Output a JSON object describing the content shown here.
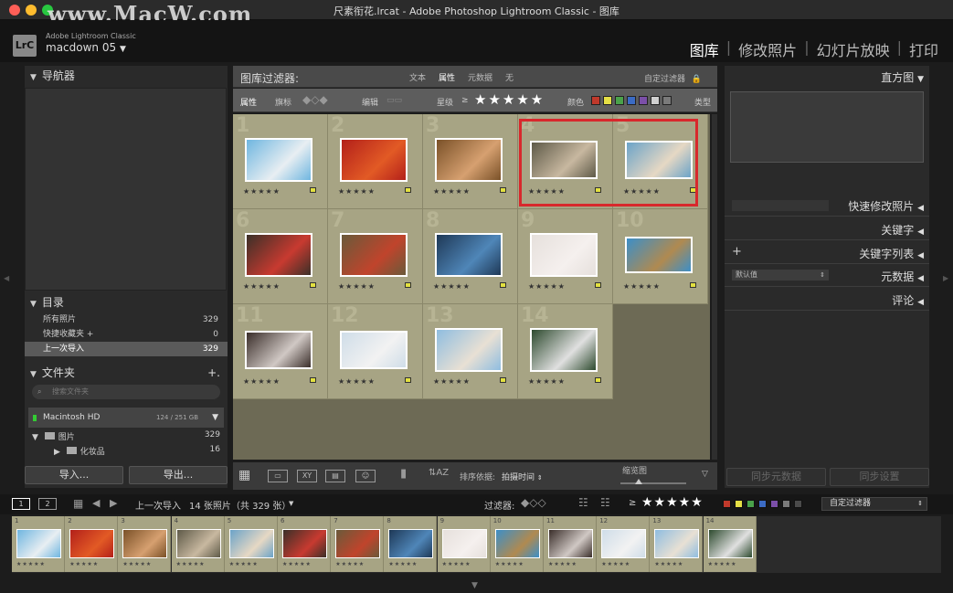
{
  "window": {
    "title": "尺素衔花.lrcat - Adobe Photoshop Lightroom Classic - 图库",
    "watermark": "www.MacW.com"
  },
  "identity": {
    "logo": "LrC",
    "app_name": "Adobe Lightroom Classic",
    "catalog": "macdown 05",
    "dropdown": "▼"
  },
  "modules": [
    "图库",
    "修改照片",
    "幻灯片放映",
    "打印"
  ],
  "left_panel": {
    "navigator": "导航器",
    "catalog": {
      "title": "目录",
      "items": [
        {
          "label": "所有照片",
          "count": "329"
        },
        {
          "label": "快捷收藏夹 +",
          "count": "0"
        },
        {
          "label": "上一次导入",
          "count": "329"
        }
      ]
    },
    "folders": {
      "title": "文件夹",
      "add": "+.",
      "search_placeholder": "搜索文件夹",
      "volume": "Macintosh HD",
      "volume_size": "124 / 251 GB",
      "items": [
        {
          "label": "图片",
          "count": "329"
        },
        {
          "label": "化妆品",
          "count": "16"
        }
      ]
    },
    "import_button": "导入...",
    "export_button": "导出..."
  },
  "filter_bar": {
    "label": "图库过滤器:",
    "tabs": [
      "文本",
      "属性",
      "元数据",
      "无"
    ],
    "active_tab": "属性",
    "custom": "自定过滤器",
    "lock_icon": "lock-icon"
  },
  "attribute_bar": {
    "attr": "属性",
    "flag": "旗标",
    "edit": "编辑",
    "rating": "星级",
    "gte": "≥",
    "stars": "★★★★★",
    "color": "颜色",
    "type": "类型",
    "colors": [
      "#c0392b",
      "#e6e045",
      "#4aa24a",
      "#3b6bc4",
      "#7b4fa8",
      "#d0d0d0",
      "#7a7a7a"
    ]
  },
  "grid": {
    "cells": [
      {
        "num": "1",
        "rating": "★★★★★",
        "tw": 74,
        "th": 48,
        "c1": "#6fb6e0",
        "c2": "#e8eef2"
      },
      {
        "num": "2",
        "rating": "★★★★★",
        "tw": 74,
        "th": 48,
        "c1": "#b3201a",
        "c2": "#e25a25"
      },
      {
        "num": "3",
        "rating": "★★★★★",
        "tw": 74,
        "th": 48,
        "c1": "#7a5128",
        "c2": "#d6a070"
      },
      {
        "num": "4",
        "rating": "★★★★★",
        "tw": 74,
        "th": 42,
        "c1": "#5e5a48",
        "c2": "#c8b8a0"
      },
      {
        "num": "5",
        "rating": "★★★★★",
        "tw": 74,
        "th": 42,
        "c1": "#6ba3c8",
        "c2": "#e6d8c4"
      },
      {
        "num": "6",
        "rating": "★★★★★",
        "tw": 74,
        "th": 48,
        "c1": "#3a3028",
        "c2": "#c83a30"
      },
      {
        "num": "7",
        "rating": "★★★★★",
        "tw": 74,
        "th": 48,
        "c1": "#6a5a3a",
        "c2": "#c0442c"
      },
      {
        "num": "8",
        "rating": "★★★★★",
        "tw": 74,
        "th": 48,
        "c1": "#1e3856",
        "c2": "#4f86b8"
      },
      {
        "num": "9",
        "rating": "★★★★★",
        "tw": 74,
        "th": 48,
        "c1": "#e6e0dc",
        "c2": "#f5f0ee"
      },
      {
        "num": "10",
        "rating": "★★★★★",
        "tw": 74,
        "th": 40,
        "c1": "#3c8fc8",
        "c2": "#b08a50"
      },
      {
        "num": "11",
        "rating": "★★★★★",
        "tw": 74,
        "th": 42,
        "c1": "#3a2e2a",
        "c2": "#d0c8c4"
      },
      {
        "num": "12",
        "rating": "★★★★★",
        "tw": 74,
        "th": 42,
        "c1": "#cfdde8",
        "c2": "#f2f2f2"
      },
      {
        "num": "13",
        "rating": "★★★★★",
        "tw": 74,
        "th": 48,
        "c1": "#8fbde0",
        "c2": "#e8e0d4"
      },
      {
        "num": "14",
        "rating": "★★★★★",
        "tw": 74,
        "th": 48,
        "c1": "#2d4a2e",
        "c2": "#e0e0e0"
      }
    ]
  },
  "toolbar": {
    "sort_label": "排序依据:",
    "sort_value": "拍摄时间",
    "thumb_label": "缩览图"
  },
  "right_panel": {
    "histogram": "直方图",
    "quick_develop": "快速修改照片",
    "keywords": "关键字",
    "keyword_list": "关键字列表",
    "metadata": "元数据",
    "comments": "评论",
    "default_value": "默认值",
    "plus": "+",
    "sync_metadata": "同步元数据",
    "sync_settings": "同步设置"
  },
  "status": {
    "mon1": "1",
    "mon2": "2",
    "source": "上一次导入",
    "count": "14 张照片（共 329 张）",
    "filter": "过滤器:",
    "gte": "≥",
    "stars": "★★★★★",
    "custom": "自定过滤器",
    "colors": [
      "#c0392b",
      "#e6e045",
      "#4aa24a",
      "#3b6bc4",
      "#7b4fa8",
      "#7a7a7a",
      "#4a4a4a"
    ]
  }
}
